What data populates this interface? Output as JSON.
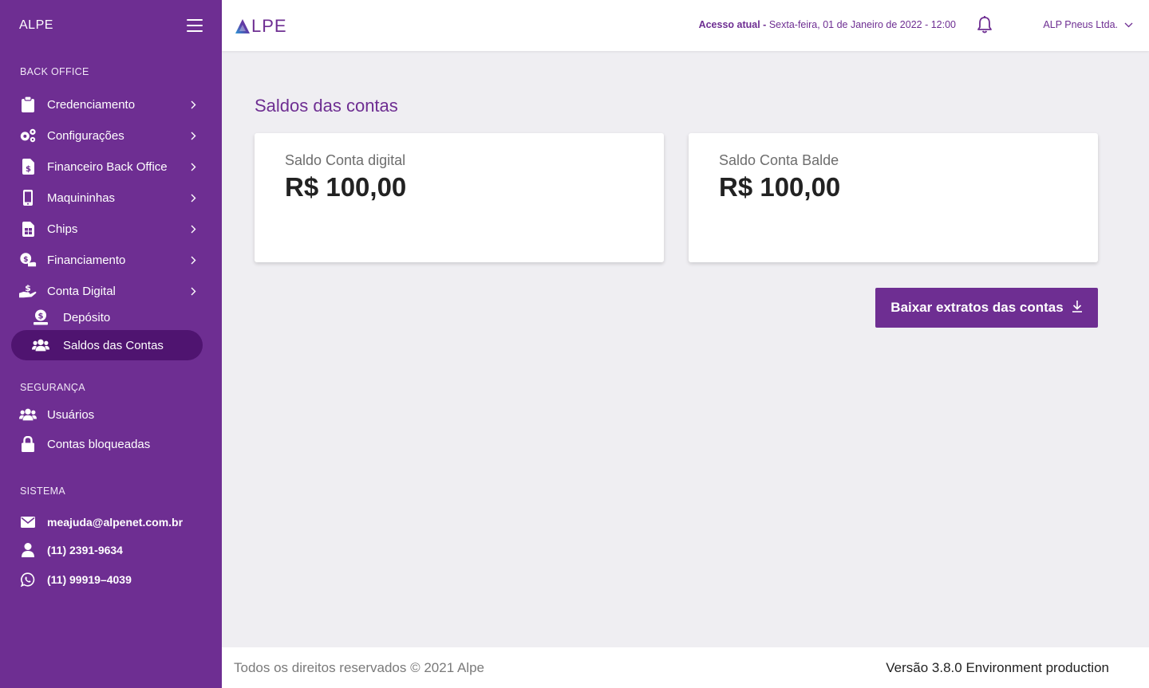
{
  "sidebar": {
    "brand": "ALPE",
    "sections": {
      "backoffice": "BACK OFFICE",
      "seguranca": "SEGURANÇA",
      "sistema": "SISTEMA"
    },
    "items": [
      {
        "label": "Credenciamento",
        "icon": "clipboard-icon"
      },
      {
        "label": "Configurações",
        "icon": "gears-icon"
      },
      {
        "label": "Financeiro Back Office",
        "icon": "invoice-dollar-icon"
      },
      {
        "label": "Maquininhas",
        "icon": "mobile-icon"
      },
      {
        "label": "Chips",
        "icon": "sim-card-icon"
      },
      {
        "label": "Financiamento",
        "icon": "hand-coin-icon"
      },
      {
        "label": "Conta Digital",
        "icon": "hand-dollar-icon"
      }
    ],
    "subitems": [
      {
        "label": "Depósito",
        "icon": "money-bag-icon"
      },
      {
        "label": "Saldos das Contas",
        "icon": "users-icon"
      }
    ],
    "security": [
      {
        "label": "Usuários",
        "icon": "users-icon"
      },
      {
        "label": "Contas bloqueadas",
        "icon": "lock-icon"
      }
    ],
    "contacts": [
      {
        "label": "meajuda@alpenet.com.br",
        "icon": "envelope-icon"
      },
      {
        "label": "(11) 2391-9634",
        "icon": "user-icon"
      },
      {
        "label": "(11) 99919–4039",
        "icon": "whatsapp-icon"
      }
    ]
  },
  "header": {
    "logo": "LPE",
    "access_label": "Acesso atual -",
    "access_date": "Sexta-feira, 01 de Janeiro  de 2022 - 12:00",
    "company": "ALP Pneus Ltda."
  },
  "main": {
    "title": "Saldos das contas",
    "cards": [
      {
        "label": "Saldo Conta digital",
        "value": "R$ 100,00"
      },
      {
        "label": "Saldo Conta Balde",
        "value": "R$ 100,00"
      }
    ],
    "download_button": "Baixar extratos das contas"
  },
  "footer": {
    "copyright": "Todos os direitos reservados © 2021 Alpe",
    "version": "Versão 3.8.0 Environment production"
  },
  "colors": {
    "primary": "#6e2e92",
    "active": "#4f1470",
    "background": "#efeef2"
  }
}
